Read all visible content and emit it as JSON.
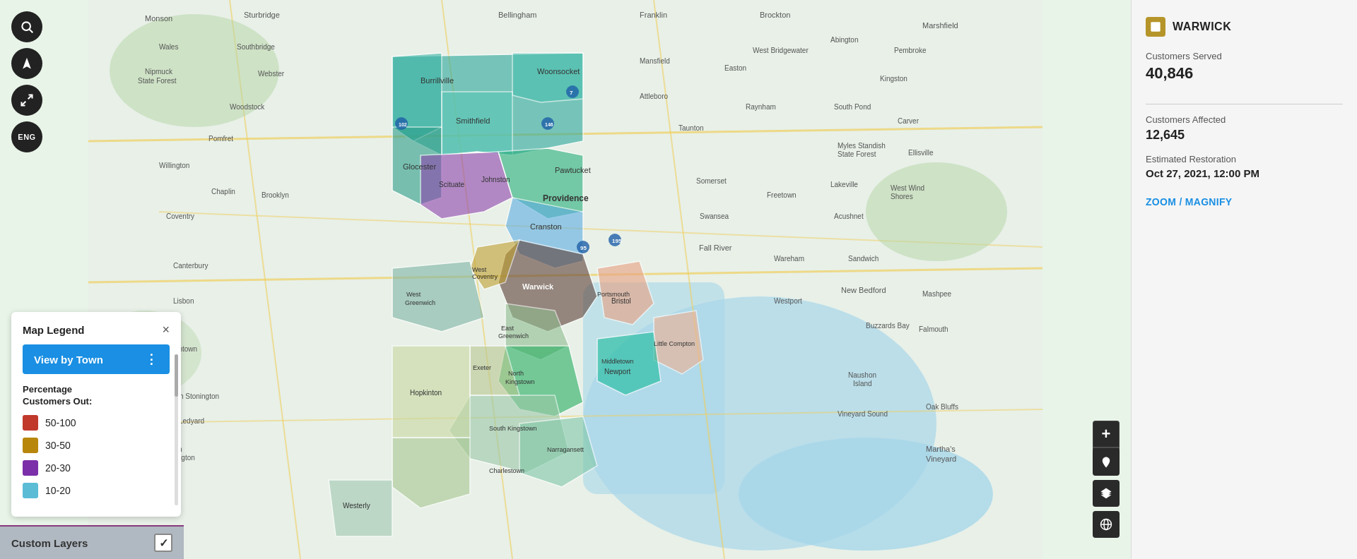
{
  "toolbar": {
    "search_icon": "🔍",
    "navigate_icon": "➤",
    "fullscreen_icon": "⛶",
    "language_label": "ENG"
  },
  "legend": {
    "title": "Map Legend",
    "close_label": "×",
    "view_by_town_label": "View by Town",
    "view_by_town_dots": "⋮",
    "subtitle": "Percentage\nCustomers Out:",
    "items": [
      {
        "range": "50-100",
        "color": "#c0392b"
      },
      {
        "range": "30-50",
        "color": "#b8860b"
      },
      {
        "range": "20-30",
        "color": "#7b2fa8"
      },
      {
        "range": "10-20",
        "color": "#5bbcd6"
      }
    ]
  },
  "custom_layers": {
    "label": "Custom Layers",
    "checked": true,
    "check_icon": "✓"
  },
  "zoom_controls": {
    "zoom_in": "+",
    "zoom_out": "−"
  },
  "map_extra_buttons": {
    "pin_icon": "📍",
    "layers_icon": "🗺",
    "globe_icon": "🌐"
  },
  "right_panel": {
    "location": {
      "icon": "◼",
      "name": "WARWICK"
    },
    "customers_served": {
      "label": "Customers Served",
      "value": "40,846"
    },
    "customers_affected": {
      "label": "Customers Affected",
      "value": "12,645"
    },
    "estimated_restoration": {
      "label": "Estimated Restoration",
      "value": "Oct 27, 2021, 12:00 PM"
    },
    "zoom_magnify_label": "ZOOM / MAGNIFY"
  }
}
